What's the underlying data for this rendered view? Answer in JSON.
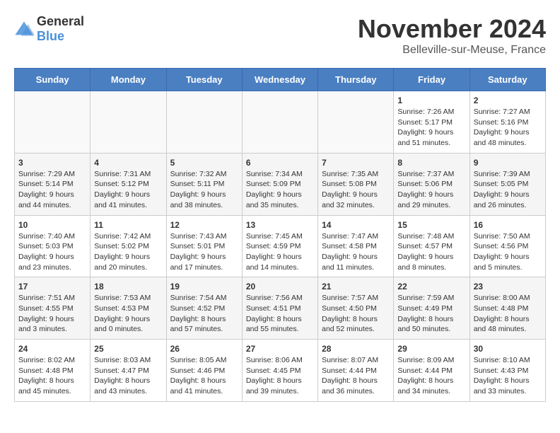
{
  "header": {
    "logo_general": "General",
    "logo_blue": "Blue",
    "month_title": "November 2024",
    "location": "Belleville-sur-Meuse, France"
  },
  "weekdays": [
    "Sunday",
    "Monday",
    "Tuesday",
    "Wednesday",
    "Thursday",
    "Friday",
    "Saturday"
  ],
  "weeks": [
    [
      {
        "day": "",
        "info": ""
      },
      {
        "day": "",
        "info": ""
      },
      {
        "day": "",
        "info": ""
      },
      {
        "day": "",
        "info": ""
      },
      {
        "day": "",
        "info": ""
      },
      {
        "day": "1",
        "info": "Sunrise: 7:26 AM\nSunset: 5:17 PM\nDaylight: 9 hours and 51 minutes."
      },
      {
        "day": "2",
        "info": "Sunrise: 7:27 AM\nSunset: 5:16 PM\nDaylight: 9 hours and 48 minutes."
      }
    ],
    [
      {
        "day": "3",
        "info": "Sunrise: 7:29 AM\nSunset: 5:14 PM\nDaylight: 9 hours and 44 minutes."
      },
      {
        "day": "4",
        "info": "Sunrise: 7:31 AM\nSunset: 5:12 PM\nDaylight: 9 hours and 41 minutes."
      },
      {
        "day": "5",
        "info": "Sunrise: 7:32 AM\nSunset: 5:11 PM\nDaylight: 9 hours and 38 minutes."
      },
      {
        "day": "6",
        "info": "Sunrise: 7:34 AM\nSunset: 5:09 PM\nDaylight: 9 hours and 35 minutes."
      },
      {
        "day": "7",
        "info": "Sunrise: 7:35 AM\nSunset: 5:08 PM\nDaylight: 9 hours and 32 minutes."
      },
      {
        "day": "8",
        "info": "Sunrise: 7:37 AM\nSunset: 5:06 PM\nDaylight: 9 hours and 29 minutes."
      },
      {
        "day": "9",
        "info": "Sunrise: 7:39 AM\nSunset: 5:05 PM\nDaylight: 9 hours and 26 minutes."
      }
    ],
    [
      {
        "day": "10",
        "info": "Sunrise: 7:40 AM\nSunset: 5:03 PM\nDaylight: 9 hours and 23 minutes."
      },
      {
        "day": "11",
        "info": "Sunrise: 7:42 AM\nSunset: 5:02 PM\nDaylight: 9 hours and 20 minutes."
      },
      {
        "day": "12",
        "info": "Sunrise: 7:43 AM\nSunset: 5:01 PM\nDaylight: 9 hours and 17 minutes."
      },
      {
        "day": "13",
        "info": "Sunrise: 7:45 AM\nSunset: 4:59 PM\nDaylight: 9 hours and 14 minutes."
      },
      {
        "day": "14",
        "info": "Sunrise: 7:47 AM\nSunset: 4:58 PM\nDaylight: 9 hours and 11 minutes."
      },
      {
        "day": "15",
        "info": "Sunrise: 7:48 AM\nSunset: 4:57 PM\nDaylight: 9 hours and 8 minutes."
      },
      {
        "day": "16",
        "info": "Sunrise: 7:50 AM\nSunset: 4:56 PM\nDaylight: 9 hours and 5 minutes."
      }
    ],
    [
      {
        "day": "17",
        "info": "Sunrise: 7:51 AM\nSunset: 4:55 PM\nDaylight: 9 hours and 3 minutes."
      },
      {
        "day": "18",
        "info": "Sunrise: 7:53 AM\nSunset: 4:53 PM\nDaylight: 9 hours and 0 minutes."
      },
      {
        "day": "19",
        "info": "Sunrise: 7:54 AM\nSunset: 4:52 PM\nDaylight: 8 hours and 57 minutes."
      },
      {
        "day": "20",
        "info": "Sunrise: 7:56 AM\nSunset: 4:51 PM\nDaylight: 8 hours and 55 minutes."
      },
      {
        "day": "21",
        "info": "Sunrise: 7:57 AM\nSunset: 4:50 PM\nDaylight: 8 hours and 52 minutes."
      },
      {
        "day": "22",
        "info": "Sunrise: 7:59 AM\nSunset: 4:49 PM\nDaylight: 8 hours and 50 minutes."
      },
      {
        "day": "23",
        "info": "Sunrise: 8:00 AM\nSunset: 4:48 PM\nDaylight: 8 hours and 48 minutes."
      }
    ],
    [
      {
        "day": "24",
        "info": "Sunrise: 8:02 AM\nSunset: 4:48 PM\nDaylight: 8 hours and 45 minutes."
      },
      {
        "day": "25",
        "info": "Sunrise: 8:03 AM\nSunset: 4:47 PM\nDaylight: 8 hours and 43 minutes."
      },
      {
        "day": "26",
        "info": "Sunrise: 8:05 AM\nSunset: 4:46 PM\nDaylight: 8 hours and 41 minutes."
      },
      {
        "day": "27",
        "info": "Sunrise: 8:06 AM\nSunset: 4:45 PM\nDaylight: 8 hours and 39 minutes."
      },
      {
        "day": "28",
        "info": "Sunrise: 8:07 AM\nSunset: 4:44 PM\nDaylight: 8 hours and 36 minutes."
      },
      {
        "day": "29",
        "info": "Sunrise: 8:09 AM\nSunset: 4:44 PM\nDaylight: 8 hours and 34 minutes."
      },
      {
        "day": "30",
        "info": "Sunrise: 8:10 AM\nSunset: 4:43 PM\nDaylight: 8 hours and 33 minutes."
      }
    ]
  ]
}
